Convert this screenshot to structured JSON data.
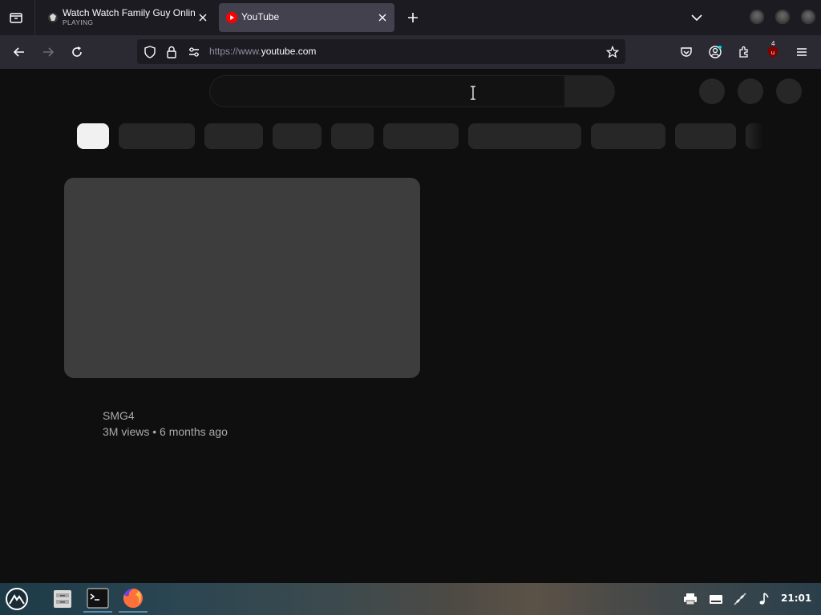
{
  "browser": {
    "tabs": [
      {
        "title": "Watch Watch Family Guy Onlin",
        "subtitle": "PLAYING",
        "active": false
      },
      {
        "title": "YouTube",
        "active": true
      }
    ],
    "url": {
      "prefix": "https://www.",
      "domain": "youtube.com"
    },
    "extension_badge": "4",
    "icons": {
      "tab_list": "tab-list-icon",
      "back": "arrow-left-icon",
      "forward": "arrow-right-icon",
      "reload": "reload-icon",
      "tracking": "shield-icon",
      "lock": "lock-icon",
      "permissions": "sliders-icon",
      "bookmark": "star-icon",
      "pocket": "pocket-icon",
      "account": "account-icon",
      "extensions": "puzzle-icon",
      "ublock": "ublock-icon",
      "menu": "hamburger-icon"
    }
  },
  "video": {
    "channel": "SMG4",
    "stats": "3M views • 6 months ago"
  },
  "taskbar": {
    "clock": "21:01",
    "apps": [
      "launcher",
      "file-manager",
      "terminal",
      "firefox"
    ]
  },
  "colors": {
    "page_bg": "#0f0f0f",
    "chip": "#272727",
    "chip_active": "#f1f1f1",
    "thumbnail_placeholder": "#3d3d3d",
    "tabstrip": "#1c1b22",
    "navbar": "#2b2a33",
    "youtube_red": "#ff0000"
  }
}
